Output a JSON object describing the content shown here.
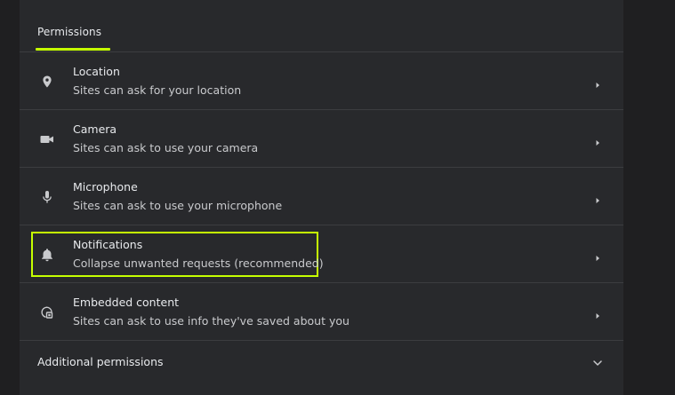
{
  "permissions": {
    "section_title": "Permissions",
    "accent_color": "#c6ff00",
    "items": [
      {
        "icon": "location-pin-icon",
        "title": "Location",
        "subtitle": "Sites can ask for your location"
      },
      {
        "icon": "camera-icon",
        "title": "Camera",
        "subtitle": "Sites can ask to use your camera"
      },
      {
        "icon": "microphone-icon",
        "title": "Microphone",
        "subtitle": "Sites can ask to use your microphone"
      },
      {
        "icon": "bell-icon",
        "title": "Notifications",
        "subtitle": "Collapse unwanted requests (recommended)",
        "highlighted": true
      },
      {
        "icon": "embedded-content-icon",
        "title": "Embedded content",
        "subtitle": "Sites can ask to use info they've saved about you"
      }
    ],
    "additional_label": "Additional permissions"
  }
}
